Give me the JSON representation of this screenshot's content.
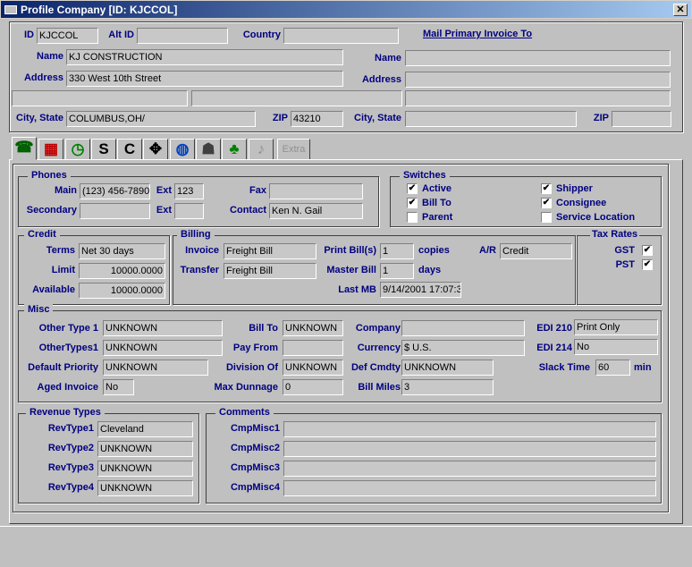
{
  "window": {
    "title": "Profile Company [ID: KJCCOL]",
    "close": "✕"
  },
  "header": {
    "id_label": "ID",
    "id": "KJCCOL",
    "altid_label": "Alt ID",
    "altid": "",
    "country_label": "Country",
    "country": "",
    "mail_link": "Mail Primary Invoice To",
    "name_label": "Name",
    "name": "KJ CONSTRUCTION",
    "address_label": "Address",
    "address": "330 West 10th Street",
    "address2": "",
    "address3": "",
    "city_label": "City, State",
    "city": "COLUMBUS,OH/",
    "zip_label": "ZIP",
    "zip": "43210",
    "mail_name_label": "Name",
    "mail_name": "",
    "mail_address_label": "Address",
    "mail_address": "",
    "mail_address2": "",
    "mail_city_label": "City, State",
    "mail_city": "",
    "mail_zip_label": "ZIP",
    "mail_zip": ""
  },
  "tabs": [
    {
      "icon": "phone-icon",
      "glyph": "☎"
    },
    {
      "icon": "calendar-icon",
      "glyph": "▦"
    },
    {
      "icon": "clock-icon",
      "glyph": "◷"
    },
    {
      "icon": "s-icon",
      "glyph": "S"
    },
    {
      "icon": "c-icon",
      "glyph": "C"
    },
    {
      "icon": "move-icon",
      "glyph": "✥"
    },
    {
      "icon": "globe-icon",
      "glyph": "◍"
    },
    {
      "icon": "graduation-icon",
      "glyph": "☗"
    },
    {
      "icon": "hierarchy-icon",
      "glyph": "♣"
    },
    {
      "icon": "music-note-icon",
      "glyph": "♪"
    },
    {
      "label": "Extra"
    }
  ],
  "phones": {
    "title": "Phones",
    "main_label": "Main",
    "main": "(123) 456-7890",
    "ext_label": "Ext",
    "ext": "123",
    "secondary_label": "Secondary",
    "secondary": "",
    "ext2_label": "Ext",
    "ext2": "",
    "fax_label": "Fax",
    "fax": "",
    "contact_label": "Contact",
    "contact": "Ken N. Gail"
  },
  "switches": {
    "title": "Switches",
    "items": [
      {
        "label": "Active",
        "checked": true
      },
      {
        "label": "Bill To",
        "checked": true
      },
      {
        "label": "Parent",
        "checked": false
      },
      {
        "label": "Shipper",
        "checked": true
      },
      {
        "label": "Consignee",
        "checked": true
      },
      {
        "label": "Service Location",
        "checked": false
      }
    ]
  },
  "credit": {
    "title": "Credit",
    "terms_label": "Terms",
    "terms": "Net 30 days",
    "limit_label": "Limit",
    "limit": "10000.0000",
    "available_label": "Available",
    "available": "10000.0000"
  },
  "billing": {
    "title": "Billing",
    "invoice_label": "Invoice",
    "invoice": "Freight Bill",
    "transfer_label": "Transfer",
    "transfer": "Freight Bill",
    "print_label": "Print Bill(s)",
    "print": "1",
    "copies": "copies",
    "master_label": "Master Bill",
    "master": "1",
    "days": "days",
    "lastmb_label": "Last MB",
    "lastmb": "9/14/2001 17:07:3",
    "ar_label": "A/R",
    "ar": "Credit"
  },
  "tax": {
    "title": "Tax Rates",
    "gst_label": "GST",
    "gst": true,
    "pst_label": "PST",
    "pst": true
  },
  "misc": {
    "title": "Misc",
    "other1_label": "Other Type 1",
    "other1": "UNKNOWN",
    "others_label": "OtherTypes1",
    "others": "UNKNOWN",
    "priority_label": "Default Priority",
    "priority": "UNKNOWN",
    "aged_label": "Aged Invoice",
    "aged": "No",
    "billto_label": "Bill To",
    "billto": "UNKNOWN",
    "payfrom_label": "Pay From",
    "payfrom": "",
    "division_label": "Division Of",
    "division": "UNKNOWN",
    "dunnage_label": "Max Dunnage",
    "dunnage": "0",
    "company_label": "Company",
    "company": "",
    "currency_label": "Currency",
    "currency": "$ U.S.",
    "cmdty_label": "Def Cmdty",
    "cmdty": "UNKNOWN",
    "miles_label": "Bill Miles",
    "miles": "3",
    "edi210_label": "EDI 210",
    "edi210": "Print Only",
    "edi214_label": "EDI 214",
    "edi214": "No",
    "slack_label": "Slack Time",
    "slack": "60",
    "min": "min"
  },
  "revenue": {
    "title": "Revenue Types",
    "items": [
      {
        "label": "RevType1",
        "value": "Cleveland"
      },
      {
        "label": "RevType2",
        "value": "UNKNOWN"
      },
      {
        "label": "RevType3",
        "value": "UNKNOWN"
      },
      {
        "label": "RevType4",
        "value": "UNKNOWN"
      }
    ]
  },
  "comments": {
    "title": "Comments",
    "items": [
      {
        "label": "CmpMisc1",
        "value": ""
      },
      {
        "label": "CmpMisc2",
        "value": ""
      },
      {
        "label": "CmpMisc3",
        "value": ""
      },
      {
        "label": "CmpMisc4",
        "value": ""
      }
    ]
  }
}
